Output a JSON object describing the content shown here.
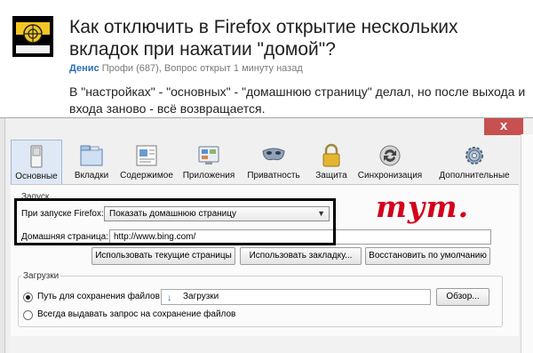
{
  "question": {
    "title": "Как отключить в Firefox открытие нескольких вкладок при нажатии \"домой\"?",
    "author": "Денис",
    "meta": "Профи (687), Вопрос открыт 1 минуту назад",
    "body": "В \"настройках\" - \"основных\" - \"домашнюю страницу\" делал, но после выхода и входа заново - всё возвращается.",
    "avatar_text": "С СССР Ваши"
  },
  "window": {
    "close_glyph": "x"
  },
  "toolbar": {
    "items": [
      {
        "label": "Основные",
        "icon": "switch-icon",
        "selected": true
      },
      {
        "label": "Вкладки",
        "icon": "tabs-icon",
        "selected": false
      },
      {
        "label": "Содержимое",
        "icon": "content-icon",
        "selected": false
      },
      {
        "label": "Приложения",
        "icon": "applications-icon",
        "selected": false
      },
      {
        "label": "Приватность",
        "icon": "privacy-mask-icon",
        "selected": false
      },
      {
        "label": "Защита",
        "icon": "padlock-icon",
        "selected": false
      },
      {
        "label": "Синхронизация",
        "icon": "sync-icon",
        "selected": false
      },
      {
        "label": "Дополнительные",
        "icon": "gear-icon",
        "selected": false
      }
    ]
  },
  "startup": {
    "group_title": "Запуск",
    "when_starts_label": "При запуске Firefox:",
    "when_starts_value": "Показать домашнюю страницу",
    "homepage_label": "Домашняя страница:",
    "homepage_value": "http://www.bing.com/",
    "btn_use_current": "Использовать текущие страницы",
    "btn_use_bookmark": "Использовать закладку...",
    "btn_restore_default": "Восстановить по умолчанию"
  },
  "annotation": {
    "text": "тут.",
    "color": "#d3001b"
  },
  "downloads": {
    "group_title": "Загрузки",
    "save_path_label": "Путь для сохранения файлов",
    "save_path_selected": true,
    "save_path_value": "Загрузки",
    "browse_button": "Обзор...",
    "always_ask_label": "Всегда выдавать запрос на сохранение файлов",
    "always_ask_selected": false
  }
}
